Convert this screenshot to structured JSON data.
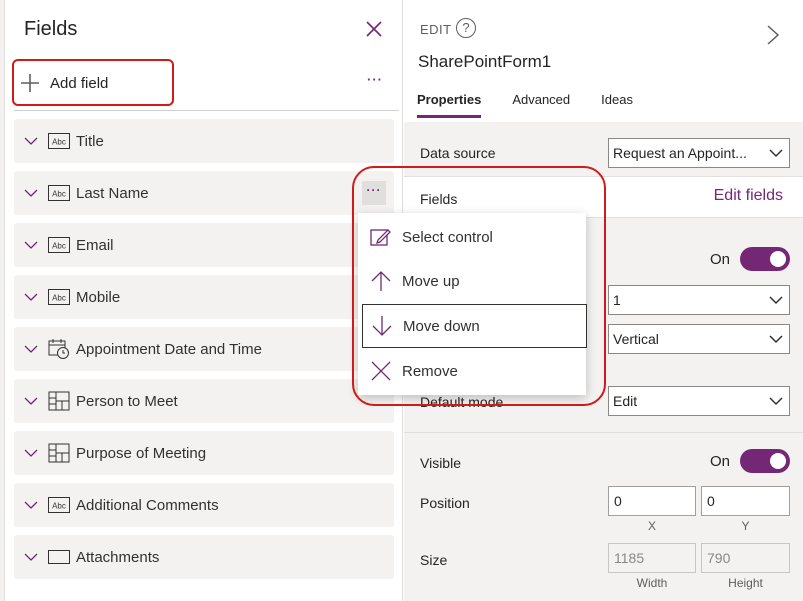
{
  "fields_pane": {
    "title": "Fields",
    "add_field_label": "Add field",
    "more_label": "···",
    "items": [
      {
        "label": "Title",
        "icon": "text-abc-icon"
      },
      {
        "label": "Last Name",
        "icon": "text-abc-icon"
      },
      {
        "label": "Email",
        "icon": "text-abc-icon"
      },
      {
        "label": "Mobile",
        "icon": "text-abc-icon"
      },
      {
        "label": "Appointment Date and Time",
        "icon": "calendar-clock-icon"
      },
      {
        "label": "Person to Meet",
        "icon": "lookup-grid-icon"
      },
      {
        "label": "Purpose of Meeting",
        "icon": "lookup-grid-icon"
      },
      {
        "label": "Additional Comments",
        "icon": "text-abc-icon"
      },
      {
        "label": "Attachments",
        "icon": "attachment-box-icon"
      }
    ]
  },
  "context_menu": {
    "items": [
      {
        "label": "Select control",
        "icon": "edit-select-icon"
      },
      {
        "label": "Move up",
        "icon": "arrow-up-icon"
      },
      {
        "label": "Move down",
        "icon": "arrow-down-icon"
      },
      {
        "label": "Remove",
        "icon": "close-icon"
      }
    ]
  },
  "properties_pane": {
    "mode_label": "EDIT",
    "help_symbol": "?",
    "form_name": "SharePointForm1",
    "tabs": [
      "Properties",
      "Advanced",
      "Ideas"
    ],
    "data_source_label": "Data source",
    "data_source_value": "Request an Appoint...",
    "fields_label": "Fields",
    "edit_fields_label": "Edit fields",
    "snap_toggle_text": "On",
    "columns_value": "1",
    "layout_value": "Vertical",
    "default_mode_label": "Default mode",
    "default_mode_value": "Edit",
    "visible_label": "Visible",
    "visible_toggle_text": "On",
    "position_label": "Position",
    "position_x": "0",
    "position_y": "0",
    "x_label": "X",
    "y_label": "Y",
    "size_label": "Size",
    "width_value": "1185",
    "height_value": "790",
    "width_label": "Width",
    "height_label": "Height"
  },
  "colors": {
    "accent": "#742774",
    "annotation_red": "#d11a1a"
  }
}
